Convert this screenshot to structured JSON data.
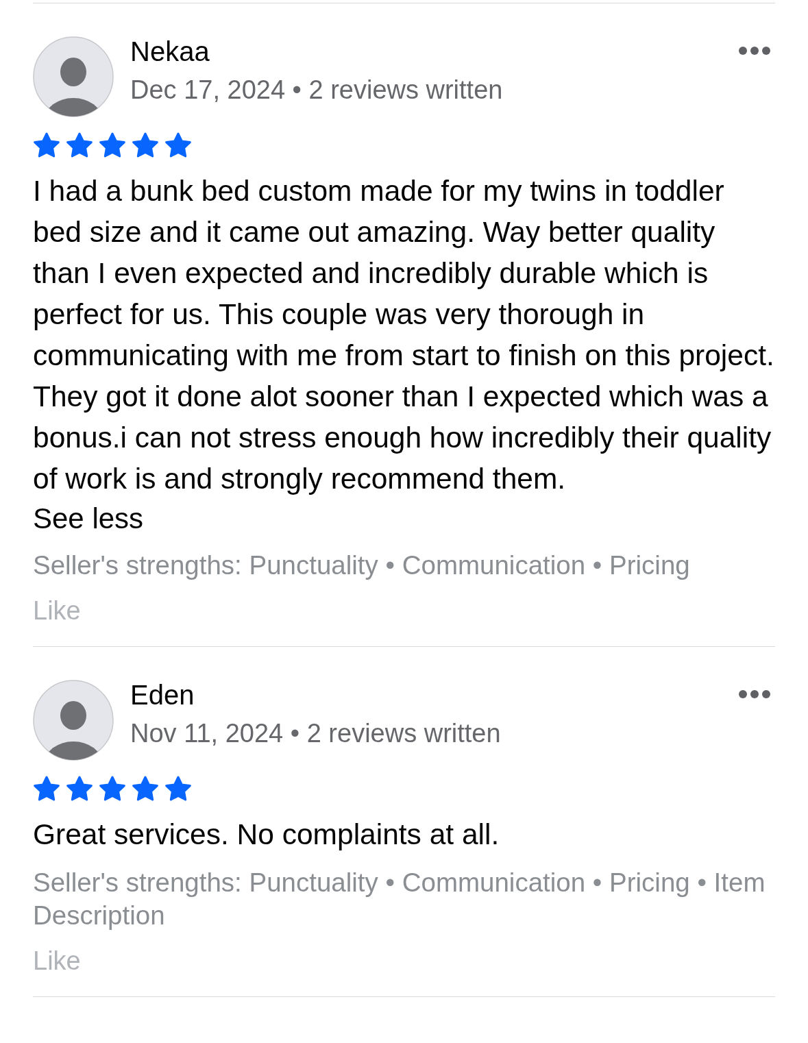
{
  "reviews": [
    {
      "name": "Nekaa",
      "date": "Dec 17, 2024",
      "separator": "•",
      "reviews_written": "2 reviews written",
      "stars": 5,
      "text": "I had a bunk bed custom made for my twins in toddler bed size and it came out amazing. Way better quality than I even expected and incredibly durable which is perfect for us. This couple was very thorough in communicating with me from start to finish on this project. They got it done alot sooner than I expected which was a bonus.i can not stress enough how incredibly their quality of work is and strongly recommend them.",
      "toggle": "See less",
      "strengths": "Seller's strengths: Punctuality • Communication • Pricing",
      "like": "Like"
    },
    {
      "name": "Eden",
      "date": "Nov 11, 2024",
      "separator": "•",
      "reviews_written": "2 reviews written",
      "stars": 5,
      "text": "Great services. No complaints at all.",
      "strengths": "Seller's strengths: Punctuality • Communication • Pricing • Item Description",
      "like": "Like"
    }
  ]
}
